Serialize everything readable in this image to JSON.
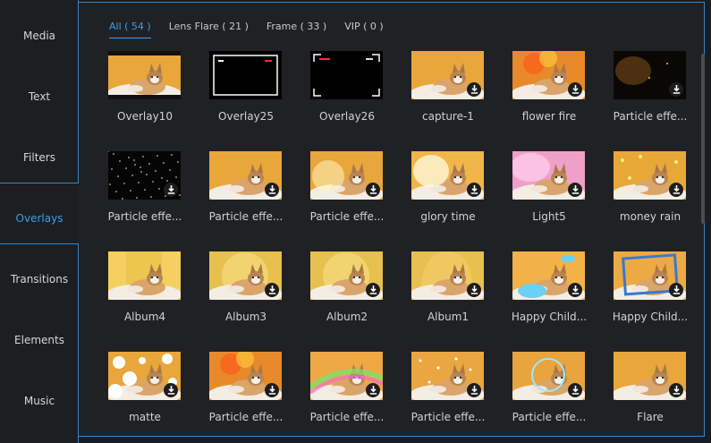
{
  "sidebar": {
    "items": [
      {
        "label": "Media"
      },
      {
        "label": "Text"
      },
      {
        "label": "Filters"
      },
      {
        "label": "Overlays"
      },
      {
        "label": "Transitions"
      },
      {
        "label": "Elements"
      },
      {
        "label": "Music"
      }
    ],
    "active": "Overlays"
  },
  "tabs": [
    {
      "label": "All ( 54 )"
    },
    {
      "label": "Lens Flare ( 21 )"
    },
    {
      "label": "Frame ( 33 )"
    },
    {
      "label": "VIP ( 0 )"
    }
  ],
  "colors": {
    "accent": "#3f9fe8",
    "border": "#3b83c7",
    "background": "#1f2125"
  },
  "items": [
    {
      "label": "Overlay10",
      "style": "filmstrip",
      "download": false
    },
    {
      "label": "Overlay25",
      "style": "black-frame",
      "download": false
    },
    {
      "label": "Overlay26",
      "style": "black-corners",
      "download": false
    },
    {
      "label": "capture-1",
      "style": "warm",
      "download": true
    },
    {
      "label": "flower fire",
      "style": "fire",
      "download": true
    },
    {
      "label": "Particle effe...",
      "style": "dark-particles",
      "download": true
    },
    {
      "label": "Particle effe...",
      "style": "star-dark",
      "download": true
    },
    {
      "label": "Particle effe...",
      "style": "warm",
      "download": true
    },
    {
      "label": "Particle effe...",
      "style": "warm-glow",
      "download": true
    },
    {
      "label": "glory time",
      "style": "bright",
      "download": true
    },
    {
      "label": "Light5",
      "style": "pink",
      "download": true
    },
    {
      "label": "money rain",
      "style": "gold",
      "download": true
    },
    {
      "label": "Album4",
      "style": "album4",
      "download": false
    },
    {
      "label": "Album3",
      "style": "album",
      "download": true
    },
    {
      "label": "Album2",
      "style": "album",
      "download": true
    },
    {
      "label": "Album1",
      "style": "album1",
      "download": true
    },
    {
      "label": "Happy Child...",
      "style": "clouds",
      "download": true
    },
    {
      "label": "Happy Child...",
      "style": "blue-frame",
      "download": true
    },
    {
      "label": "matte",
      "style": "matte",
      "download": true
    },
    {
      "label": "Particle effe...",
      "style": "fire",
      "download": true
    },
    {
      "label": "Particle effe...",
      "style": "rainbow",
      "download": true
    },
    {
      "label": "Particle effe...",
      "style": "sparkle",
      "download": true
    },
    {
      "label": "Particle effe...",
      "style": "ring",
      "download": true
    },
    {
      "label": "Flare",
      "style": "warm",
      "download": true
    }
  ],
  "icons": {
    "download": "download-icon",
    "cat": "cat-photo"
  }
}
